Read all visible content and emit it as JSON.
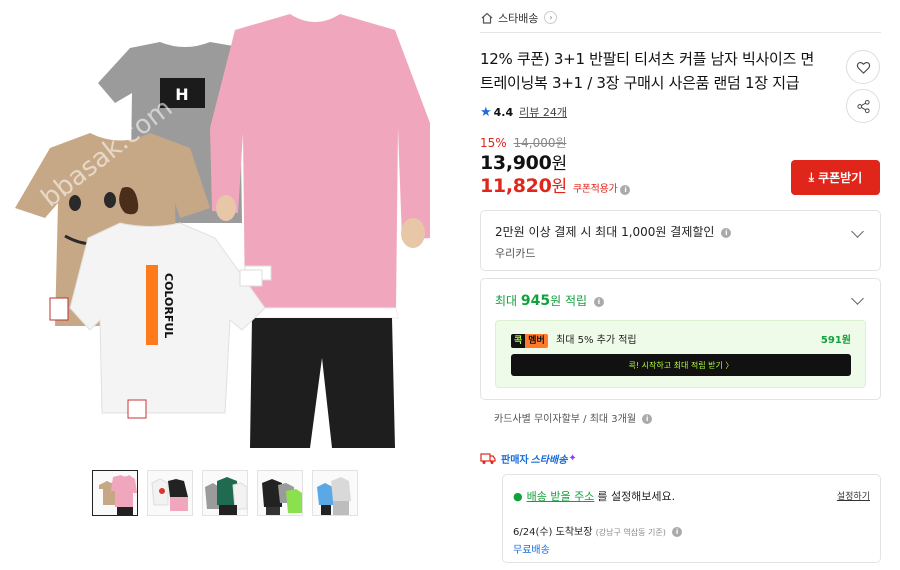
{
  "product": {
    "title": "12% 쿠폰) 3+1 반팔티 티셔츠 커플 남자 빅사이즈 면 트레이닝복 3+1 / 3장 구매시 사은품 랜덤 1장 지급",
    "image_texts": {
      "watermark": "bbasak.com",
      "shirt_print": "COLORFUL"
    }
  },
  "breadcrumb": {
    "store": "스타배송"
  },
  "rating": {
    "score": "4.4",
    "reviews": "리뷰 24개"
  },
  "price": {
    "discount_pct": "15%",
    "original": "14,000원",
    "sale": "13,900",
    "coupon": "11,820",
    "won": "원",
    "coupon_tag": "쿠폰적용가",
    "coupon_button": "쿠폰받기"
  },
  "card_benefit": {
    "title": "2만원 이상 결제 시 최대 1,000원 결제할인",
    "card": "우리카드"
  },
  "points": {
    "prefix": "최대 ",
    "amount": "945",
    "suffix": "원 적립",
    "badge_1": "콕",
    "badge_2": "멤버",
    "member_text": "최대 5% 추가 적립",
    "member_amount": "591원",
    "member_button": "콕! 시작하고 최대 적립 받기 〉"
  },
  "installment": "카드사별 무이자할부 / 최대 3개월",
  "shipping": {
    "seller_label": "판매자",
    "star_label": "스타배송",
    "address_link": "배송 받을 주소",
    "address_suffix": "를 설정해보세요.",
    "set_link": "설정하기",
    "arrive": "6/24(수) 도착보장",
    "area": "(강남구 역삼동 기준)",
    "free": "무료배송"
  },
  "colors": {
    "accent_red": "#e0251b",
    "accent_green": "#12a13c",
    "link_blue": "#1a6dd9",
    "shirt_pink": "#f0a7bd",
    "shirt_gray": "#9b9b9b",
    "shirt_beige": "#c7a886"
  }
}
